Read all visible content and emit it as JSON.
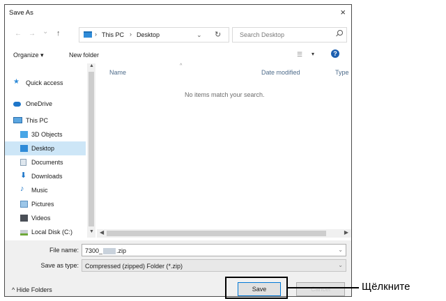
{
  "window": {
    "title": "Save As",
    "close_glyph": "×"
  },
  "address": {
    "back_glyph": "←",
    "forward_glyph": "→",
    "recent_glyph": "⌄",
    "up_glyph": "↑",
    "crumbs": [
      "This PC",
      "Desktop"
    ],
    "separator": "›",
    "dropdown_glyph": "⌄",
    "refresh_glyph": "↻"
  },
  "search": {
    "placeholder": "Search Desktop"
  },
  "toolbar": {
    "organize": "Organize ▾",
    "new_folder": "New folder",
    "view_glyph": "☰",
    "view_dropdown": "▾",
    "help": "?"
  },
  "nav": {
    "items": [
      {
        "label": "Quick access",
        "icon": "star-icon"
      },
      {
        "label": "OneDrive",
        "icon": "cloud-icon"
      },
      {
        "label": "This PC",
        "icon": "computer-icon"
      },
      {
        "label": "3D Objects",
        "icon": "cube-icon"
      },
      {
        "label": "Desktop",
        "icon": "desktop-folder-icon",
        "selected": true
      },
      {
        "label": "Documents",
        "icon": "document-icon"
      },
      {
        "label": "Downloads",
        "icon": "download-icon"
      },
      {
        "label": "Music",
        "icon": "music-icon"
      },
      {
        "label": "Pictures",
        "icon": "picture-icon"
      },
      {
        "label": "Videos",
        "icon": "video-icon"
      },
      {
        "label": "Local Disk (C:)",
        "icon": "disk-icon"
      }
    ]
  },
  "content": {
    "columns": [
      "Name",
      "Date modified",
      "Type"
    ],
    "empty_message": "No items match your search."
  },
  "fields": {
    "file_name_label": "File name:",
    "file_name_prefix": "7300_",
    "file_name_suffix": ".zip",
    "save_type_label": "Save as type:",
    "save_type_value": "Compressed (zipped) Folder (*.zip)"
  },
  "footer": {
    "hide_folders": "^ Hide Folders",
    "save": "Save",
    "cancel": "Cancel"
  },
  "annotation": {
    "text": "Щёлкните"
  },
  "colors": {
    "accent": "#0078d7",
    "selection": "#cde6f7",
    "header_text": "#4d6b8a"
  }
}
